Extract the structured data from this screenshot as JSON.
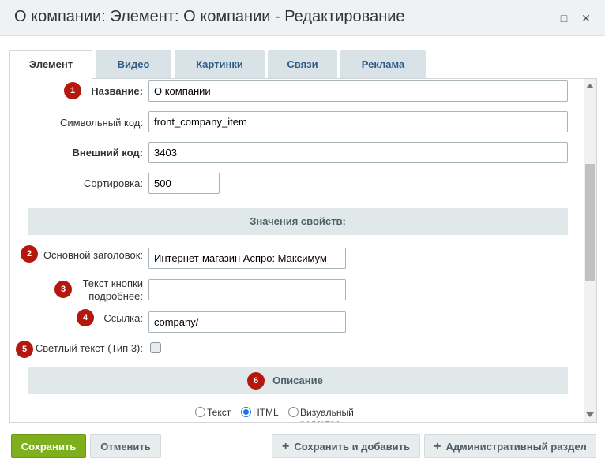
{
  "window": {
    "title": "О компании: Элемент: О компании - Редактирование",
    "maximize_glyph": "□",
    "close_glyph": "✕"
  },
  "tabs": [
    {
      "label": "Элемент",
      "active": true
    },
    {
      "label": "Видео",
      "active": false
    },
    {
      "label": "Картинки",
      "active": false
    },
    {
      "label": "Связи",
      "active": false
    },
    {
      "label": "Реклама",
      "active": false
    }
  ],
  "form": {
    "name": {
      "label": "Название:",
      "value": "О компании",
      "badge": "1"
    },
    "code": {
      "label": "Символьный код:",
      "value": "front_company_item"
    },
    "external_code": {
      "label": "Внешний код:",
      "value": "3403"
    },
    "sort": {
      "label": "Сортировка:",
      "value": "500"
    }
  },
  "properties": {
    "header": "Значения свойств:",
    "main_title": {
      "label": "Основной заголовок:",
      "value": "Интернет-магазин Аспро: Максимум",
      "badge": "2"
    },
    "button_text": {
      "label_line1": "Текст кнопки",
      "label_line2": "подробнее:",
      "value": "",
      "badge": "3"
    },
    "link": {
      "label": "Ссылка:",
      "value": "company/",
      "badge": "4"
    },
    "light_text": {
      "label": "Светлый текст (Тип 3):",
      "checked": false,
      "badge": "5"
    }
  },
  "description": {
    "header": "Описание",
    "badge": "6",
    "modes": [
      {
        "label": "Текст",
        "checked": false
      },
      {
        "label": "HTML",
        "checked": true
      },
      {
        "label": "Визуальный редактор",
        "checked": false
      }
    ]
  },
  "buttons": {
    "save": "Сохранить",
    "cancel": "Отменить",
    "save_add": "Сохранить и добавить",
    "admin": "Административный раздел",
    "plus_glyph": "+"
  },
  "colors": {
    "badge": "#b3170e",
    "save_button": "#7eaf1c",
    "tab_text": "#2e5c86",
    "section_bg": "#e0e8ea"
  }
}
